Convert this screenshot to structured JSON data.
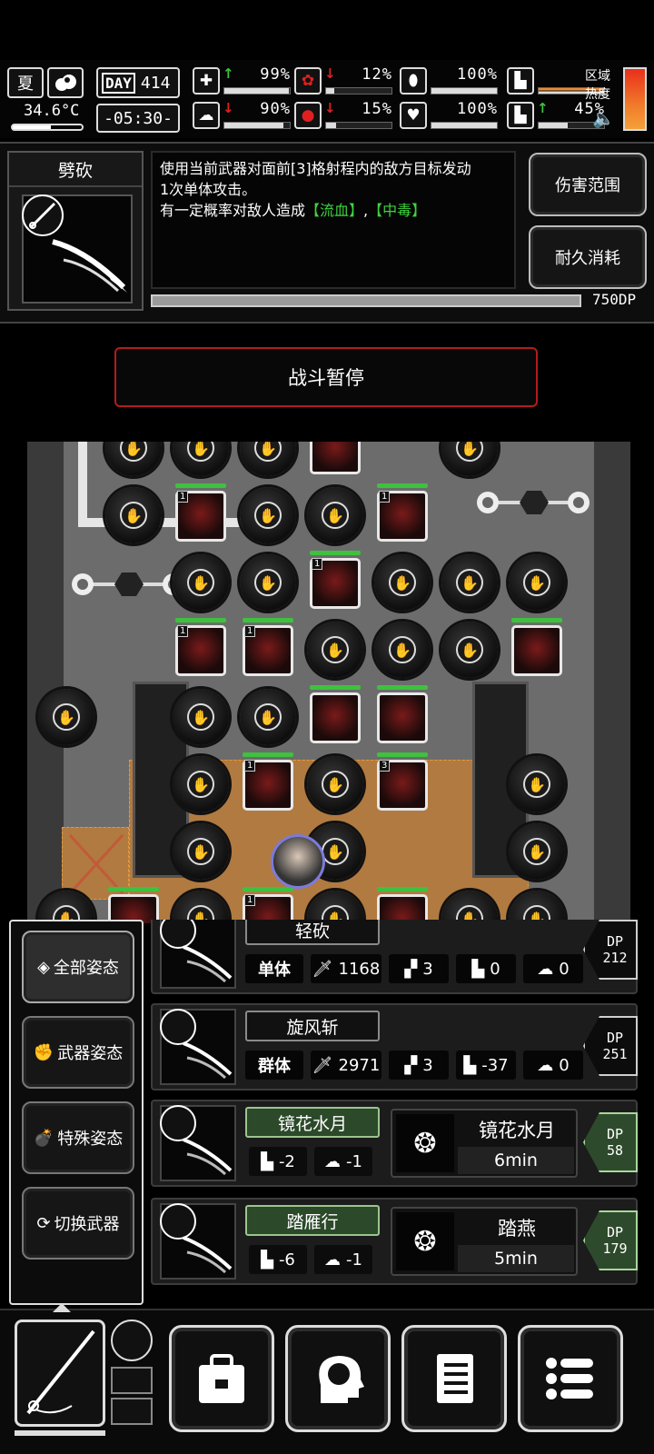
{
  "status": {
    "season": "夏",
    "temperature": "34.6°C",
    "day_label": "DAY",
    "day_value": "414",
    "time": "-05:30-",
    "stats": [
      {
        "name": "health",
        "arrow": "↑",
        "arrow_color": "#3ec13e",
        "value": "99%",
        "fill": 0.99
      },
      {
        "name": "stomach",
        "arrow": "↓",
        "arrow_color": "#e02020",
        "value": "12%",
        "fill": 0.12
      },
      {
        "name": "armor",
        "arrow": "",
        "arrow_color": "#fff",
        "value": "100%",
        "fill": 1.0
      },
      {
        "name": "stamina",
        "arrow": "",
        "arrow_color": "#fff",
        "value": "",
        "fill": 0.45
      },
      {
        "name": "brain",
        "arrow": "↓",
        "arrow_color": "#e02020",
        "value": "90%",
        "fill": 0.9
      },
      {
        "name": "blood",
        "arrow": "↓",
        "arrow_color": "#e02020",
        "value": "15%",
        "fill": 0.15
      },
      {
        "name": "heart",
        "arrow": "",
        "arrow_color": "#fff",
        "value": "100%",
        "fill": 1.0
      },
      {
        "name": "leg",
        "arrow": "↑",
        "arrow_color": "#3ec13e",
        "value": "45%",
        "fill": 0.45
      }
    ],
    "zone_heat_label_1": "区域",
    "zone_heat_label_2": "热度"
  },
  "skill": {
    "title": "劈砍",
    "desc_line1": "使用当前武器对面前[3]格射程内的敌方目标发动",
    "desc_line2": "1次单体攻击。",
    "desc_line3_prefix": "有一定概率对敌人造成",
    "tag_bleed": "【流血】",
    "tag_sep": ",",
    "tag_poison": "【中毒】",
    "btn_range": "伤害范围",
    "btn_durability": "耐久消耗",
    "dp_cost": "750DP"
  },
  "pause_button": "战斗暂停",
  "side_menu": [
    "全部姿态",
    "武器姿态",
    "特殊姿态",
    "切换武器"
  ],
  "moves": [
    {
      "name": "轻砍",
      "target": "单体",
      "attack": "1168",
      "hits": "3",
      "move": "0",
      "mind": "0",
      "dp_label": "DP",
      "dp": "212",
      "green": false
    },
    {
      "name": "旋风斩",
      "target": "群体",
      "attack": "2971",
      "hits": "3",
      "move": "-37",
      "mind": "0",
      "dp_label": "DP",
      "dp": "251",
      "green": false
    },
    {
      "name": "镜花水月",
      "move": "-2",
      "mind": "-1",
      "buff_name": "镜花水月",
      "buff_time": "6min",
      "dp_label": "DP",
      "dp": "58",
      "green": true
    },
    {
      "name": "踏雁行",
      "move": "-6",
      "mind": "-1",
      "buff_name": "踏燕",
      "buff_time": "5min",
      "dp_label": "DP",
      "dp": "179",
      "green": true
    }
  ],
  "zombie_level_1": "1",
  "zombie_level_3": "3"
}
